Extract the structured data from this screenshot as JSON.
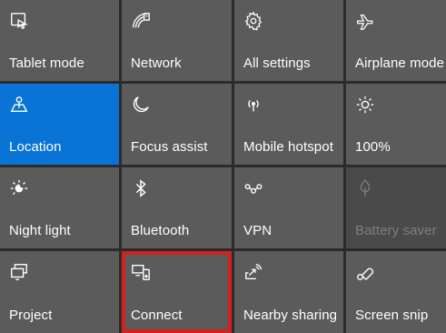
{
  "tiles": [
    {
      "label": "Tablet mode",
      "icon": "tablet-mode-icon",
      "state": "normal"
    },
    {
      "label": "Network",
      "icon": "network-icon",
      "state": "normal"
    },
    {
      "label": "All settings",
      "icon": "gear-icon",
      "state": "normal"
    },
    {
      "label": "Airplane mode",
      "icon": "airplane-icon",
      "state": "normal"
    },
    {
      "label": "Location",
      "icon": "location-icon",
      "state": "active"
    },
    {
      "label": "Focus assist",
      "icon": "moon-icon",
      "state": "normal"
    },
    {
      "label": "Mobile hotspot",
      "icon": "hotspot-icon",
      "state": "normal"
    },
    {
      "label": "100%",
      "icon": "brightness-icon",
      "state": "normal"
    },
    {
      "label": "Night light",
      "icon": "night-light-icon",
      "state": "normal"
    },
    {
      "label": "Bluetooth",
      "icon": "bluetooth-icon",
      "state": "normal"
    },
    {
      "label": "VPN",
      "icon": "vpn-icon",
      "state": "normal"
    },
    {
      "label": "Battery saver",
      "icon": "battery-saver-icon",
      "state": "disabled"
    },
    {
      "label": "Project",
      "icon": "project-icon",
      "state": "normal"
    },
    {
      "label": "Connect",
      "icon": "connect-icon",
      "state": "highlighted"
    },
    {
      "label": "Nearby sharing",
      "icon": "nearby-sharing-icon",
      "state": "normal"
    },
    {
      "label": "Screen snip",
      "icon": "screen-snip-icon",
      "state": "normal"
    }
  ],
  "colors": {
    "tile": "#5b5b5b",
    "active": "#0a74d6",
    "highlight_border": "#d81f1f",
    "disabled_text": "#8c8c8c"
  }
}
